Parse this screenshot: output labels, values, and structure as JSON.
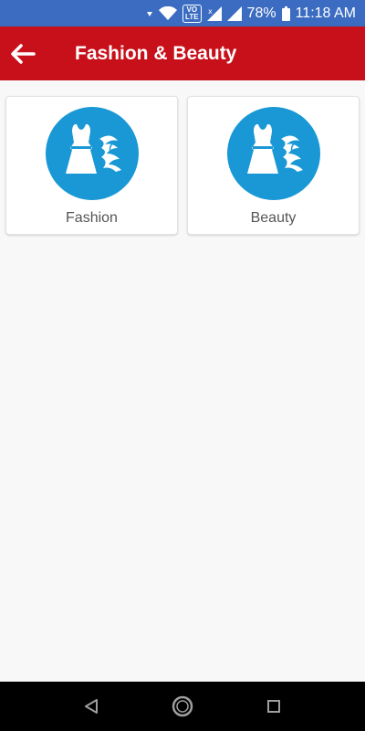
{
  "status_bar": {
    "battery_percent": "78%",
    "time": "11:18 AM",
    "volte_label": "VO\nLTE",
    "icons": [
      "notification-arrow-icon",
      "wifi-icon",
      "volte-icon",
      "signal-no-data-icon",
      "signal-icon",
      "battery-icon"
    ]
  },
  "app_bar": {
    "title": "Fashion & Beauty",
    "back_icon": "arrow-left-icon",
    "background_color": "#c8101a"
  },
  "categories": [
    {
      "label": "Fashion",
      "icon": "dress-and-hair-icon"
    },
    {
      "label": "Beauty",
      "icon": "dress-and-hair-icon"
    }
  ],
  "colors": {
    "status_bar": "#3b6cc1",
    "icon_circle": "#1a98d5",
    "label_text": "#555555"
  },
  "nav_bar": {
    "buttons": [
      "back-triangle-icon",
      "home-circle-icon",
      "recents-square-icon"
    ]
  }
}
